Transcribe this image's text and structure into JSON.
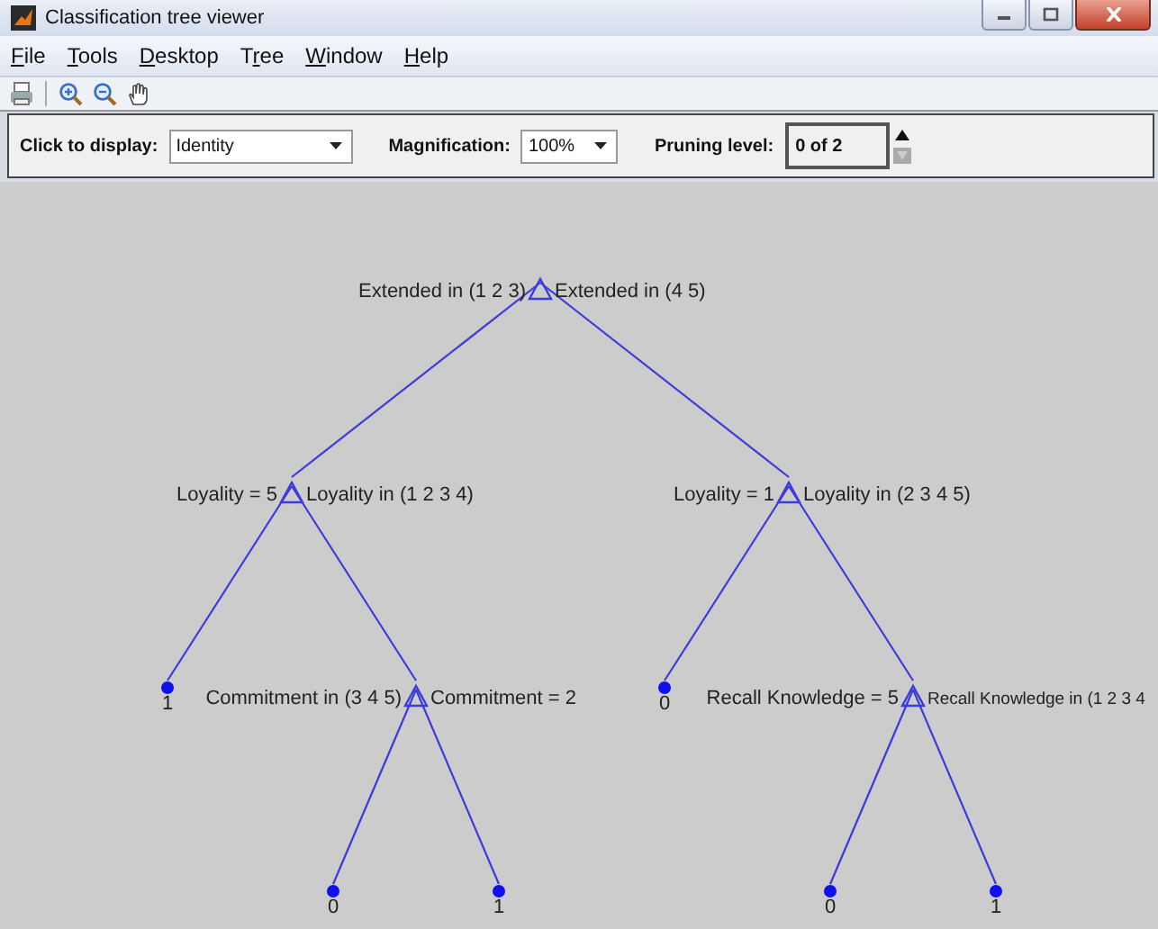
{
  "window": {
    "title": "Classification tree viewer"
  },
  "menu": [
    {
      "key": "F",
      "rest": "ile"
    },
    {
      "key": "T",
      "rest": "ools"
    },
    {
      "key": "D",
      "rest": "esktop"
    },
    {
      "lead": "T",
      "key": "r",
      "rest": "ee"
    },
    {
      "key": "W",
      "rest": "indow"
    },
    {
      "key": "H",
      "rest": "elp"
    }
  ],
  "toolbar": [
    {
      "kind": "print"
    },
    {
      "kind": "zoom-in"
    },
    {
      "kind": "zoom-out"
    },
    {
      "kind": "pan"
    }
  ],
  "controls": {
    "display": {
      "label": "Click to display:",
      "value": "Identity"
    },
    "magnification": {
      "label": "Magnification:",
      "value": "100%"
    },
    "pruning": {
      "label": "Pruning level:",
      "value": "0 of 2"
    }
  },
  "tree": {
    "kind": "split",
    "left_label": "Extended in (1 2 3)",
    "right_label": "Extended in (4 5)",
    "children": [
      {
        "kind": "split",
        "left_label": "Loyality = 5",
        "right_label": "Loyality in (1 2 3 4)",
        "children": [
          {
            "kind": "leaf",
            "label": "1"
          },
          {
            "kind": "split",
            "left_label": "Commitment in (3 4 5)",
            "right_label": "Commitment = 2",
            "children": [
              {
                "kind": "leaf",
                "label": "0"
              },
              {
                "kind": "leaf",
                "label": "1"
              }
            ]
          }
        ]
      },
      {
        "kind": "split",
        "left_label": "Loyality = 1",
        "right_label": "Loyality in (2 3 4 5)",
        "children": [
          {
            "kind": "leaf",
            "label": "0"
          },
          {
            "kind": "split",
            "left_label": "Recall Knowledge = 5",
            "right_label": "Recall Knowledge in (1 2 3 4",
            "children": [
              {
                "kind": "leaf",
                "label": "0"
              },
              {
                "kind": "leaf",
                "label": "1"
              }
            ]
          }
        ]
      }
    ]
  }
}
